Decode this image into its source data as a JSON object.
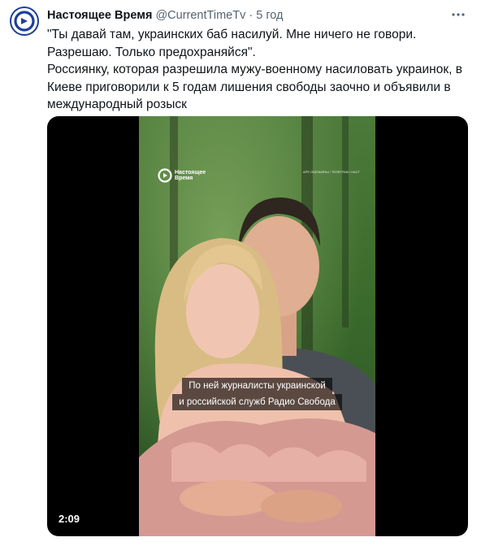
{
  "tweet": {
    "author_name": "Настоящее Время",
    "handle": "@CurrentTimeTv",
    "separator": "·",
    "time": "5 год",
    "more_icon": "more-horizontal-icon",
    "text_lines": [
      "\"Ты давай там, украинских баб насилуй. Мне ничего не говори.",
      "Разрешаю. Только предохраняйся\".",
      "Россиянку, которая разрешила мужу-военному насиловать украинок, в",
      "Киеве приговорили к 5 годам лишения свободы заочно и объявили в",
      "международный розыск"
    ]
  },
  "video": {
    "duration": "2:09",
    "logo_text": "Настоящее Время",
    "credit": "АРЕ ОБЕЗЬЯНЫ / ТЕЛЕГРАМ / НАСТ",
    "caption_lines": [
      "По ней журналисты украинской",
      "и российской служб Радио Свобода"
    ]
  },
  "colors": {
    "brand": "#1d3f9a",
    "text": "#0f1419",
    "secondary": "#536471"
  }
}
